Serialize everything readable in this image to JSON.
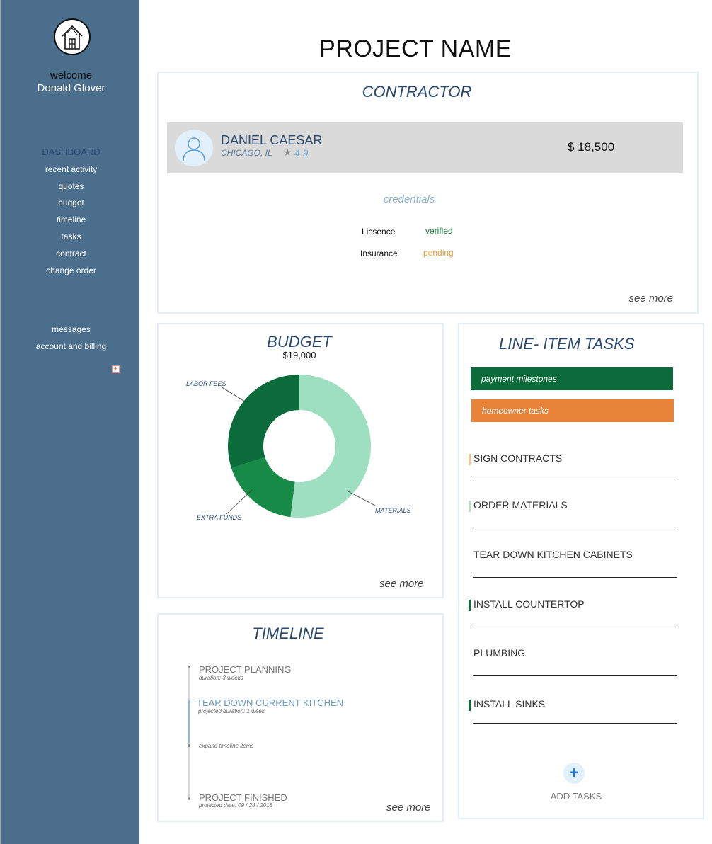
{
  "sidebar": {
    "welcome": "welcome",
    "user_name": "Donald Glover",
    "nav": [
      "DASHBOARD",
      "recent activity",
      "quotes",
      "budget",
      "timeline",
      "tasks",
      "contract",
      "change order"
    ],
    "nav2": [
      "messages",
      "account and billing"
    ]
  },
  "page_title": "PROJECT NAME",
  "contractor": {
    "title": "CONTRACTOR",
    "name": "DANIEL CAESAR",
    "location": "CHICAGO, IL",
    "rating": "4.9",
    "price": "$ 18,500",
    "credentials_title": "credentials",
    "credentials": [
      {
        "label": "Licsence",
        "status": "verified",
        "color": "#1a7a3f"
      },
      {
        "label": "Insurance",
        "status": "pending",
        "color": "#e99b2e"
      }
    ],
    "see_more": "see more"
  },
  "budget": {
    "title": "BUDGET",
    "total": "$19,000",
    "see_more": "see more",
    "chart_data": {
      "type": "pie",
      "total": "$19,000",
      "slices": [
        {
          "label": "MATERIALS",
          "value": 52,
          "color": "#9ddfc0"
        },
        {
          "label": "EXTRA FUNDS",
          "value": 18,
          "color": "#178a47"
        },
        {
          "label": "LABOR FEES",
          "value": 30,
          "color": "#0c6b3a"
        }
      ]
    }
  },
  "timeline": {
    "title": "TIMELINE",
    "items": [
      {
        "title": "PROJECT PLANNING",
        "sub": "duration: 3 weeks"
      },
      {
        "title": "TEAR DOWN CURRENT KITCHEN",
        "sub": "projected duration: 1 week"
      },
      {
        "title": "",
        "sub": "expand timeline items"
      },
      {
        "title": "PROJECT FINISHED",
        "sub": "projected date: 09 / 24 / 2018"
      }
    ],
    "see_more": "see more"
  },
  "tasks": {
    "title": "LINE- ITEM TASKS",
    "legend": [
      {
        "label": "payment milestones",
        "color": "#0c6b3a"
      },
      {
        "label": "homeowner tasks",
        "color": "#e8833a"
      }
    ],
    "items": [
      {
        "label": "SIGN CONTRACTS",
        "marker": "#f6c58e"
      },
      {
        "label": "ORDER MATERIALS",
        "marker": "#b9dcc5"
      },
      {
        "label": "TEAR DOWN KITCHEN CABINETS",
        "marker": ""
      },
      {
        "label": "INSTALL COUNTERTOP",
        "marker": "#0c6b3a"
      },
      {
        "label": "PLUMBING",
        "marker": ""
      },
      {
        "label": "INSTALL SINKS",
        "marker": "#0c6b3a"
      }
    ],
    "add_label": "ADD TASKS"
  }
}
